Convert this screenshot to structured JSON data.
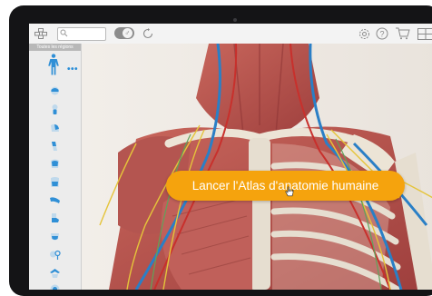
{
  "sidebar": {
    "region_header": "Toutes les régions",
    "more": "•••",
    "regions": [
      "head",
      "neck",
      "shoulder",
      "arm",
      "thorax",
      "abdomen",
      "forearm",
      "hand",
      "pelvis",
      "reproductive",
      "hip",
      "knee"
    ]
  },
  "toolbar": {
    "left_icons": [
      "grid-icon",
      "search-icon",
      "gender-toggle",
      "reset-icon"
    ],
    "right_icons": [
      "settings-icon",
      "help-icon",
      "cart-icon",
      "layout-icon"
    ],
    "gender_symbol": "♂"
  },
  "cta": {
    "label": "Lancer l'Atlas d'anatomie humaine"
  },
  "colors": {
    "accent": "#f5a30d",
    "muscle": "#b5534e",
    "bone": "#e6ded0",
    "vein": "#2a7fc6",
    "nerve": "#e5c43a",
    "artery": "#c8302c"
  }
}
